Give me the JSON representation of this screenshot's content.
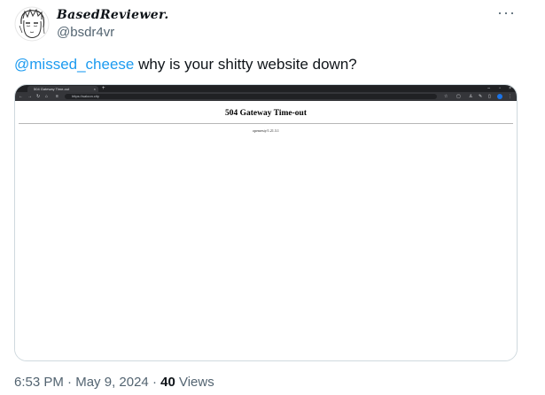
{
  "author": {
    "display_name": "BasedReviewer.",
    "handle": "@bsdr4vr",
    "avatar_icon": "anime-sketch-avatar-icon"
  },
  "more_icon": "more-horizontal-icon",
  "tweet": {
    "mention": "@missed_cheese",
    "text": "why is your shitty website down?"
  },
  "screenshot": {
    "tab_title": "504 Gateway Time-out",
    "url": "https://saloon.city",
    "page_heading": "504 Gateway Time-out",
    "server_text": "openresty/1.21.3.1"
  },
  "meta": {
    "time": "6:53 PM",
    "sep1": "·",
    "date": "May 9, 2024",
    "sep2": "·",
    "views_count": "40",
    "views_label": "Views"
  },
  "colors": {
    "link": "#1d9bf0",
    "text": "#0f1419",
    "secondary": "#536471",
    "border": "#cfd9de"
  }
}
